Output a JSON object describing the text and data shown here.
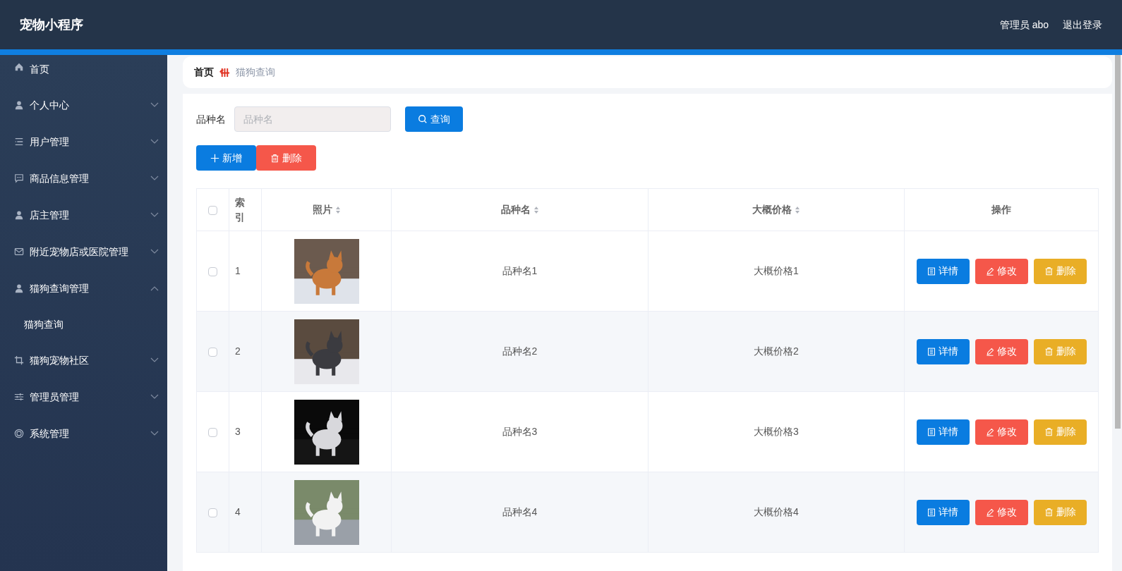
{
  "header": {
    "title": "宠物小程序",
    "user": "管理员 abo",
    "logout": "退出登录"
  },
  "sidebar": {
    "items": [
      {
        "label": "首页"
      },
      {
        "label": "个人中心",
        "expanded": false
      },
      {
        "label": "用户管理",
        "expanded": false
      },
      {
        "label": "商品信息管理",
        "expanded": false
      },
      {
        "label": "店主管理",
        "expanded": false
      },
      {
        "label": "附近宠物店或医院管理",
        "expanded": false
      },
      {
        "label": "猫狗查询管理",
        "expanded": true,
        "children": [
          {
            "label": "猫狗查询"
          }
        ]
      },
      {
        "label": "猫狗宠物社区",
        "expanded": false
      },
      {
        "label": "管理员管理",
        "expanded": false
      },
      {
        "label": "系统管理",
        "expanded": false
      }
    ]
  },
  "breadcrumb": {
    "home": "首页",
    "current": "猫狗查询"
  },
  "search": {
    "label": "品种名",
    "placeholder": "品种名",
    "button": "查询"
  },
  "actions": {
    "add": "新增",
    "delete": "删除"
  },
  "table": {
    "all_selected": false,
    "columns": [
      {
        "label": "索引",
        "sortable": false
      },
      {
        "label": "照片",
        "sortable": true
      },
      {
        "label": "品种名",
        "sortable": true
      },
      {
        "label": "大概价格",
        "sortable": true
      },
      {
        "label": "操作",
        "sortable": false
      }
    ],
    "rows": [
      {
        "selected": false,
        "index": "1",
        "breed": "品种名1",
        "price": "大概价格1",
        "buttons": {
          "detail": "详情",
          "edit": "修改",
          "delete": "删除"
        }
      },
      {
        "selected": false,
        "index": "2",
        "breed": "品种名2",
        "price": "大概价格2",
        "buttons": {
          "detail": "详情",
          "edit": "修改",
          "delete": "删除"
        }
      },
      {
        "selected": false,
        "index": "3",
        "breed": "品种名3",
        "price": "大概价格3",
        "buttons": {
          "detail": "详情",
          "edit": "修改",
          "delete": "删除"
        }
      },
      {
        "selected": false,
        "index": "4",
        "breed": "品种名4",
        "price": "大概价格4",
        "buttons": {
          "detail": "详情",
          "edit": "修改",
          "delete": "删除"
        }
      }
    ]
  }
}
